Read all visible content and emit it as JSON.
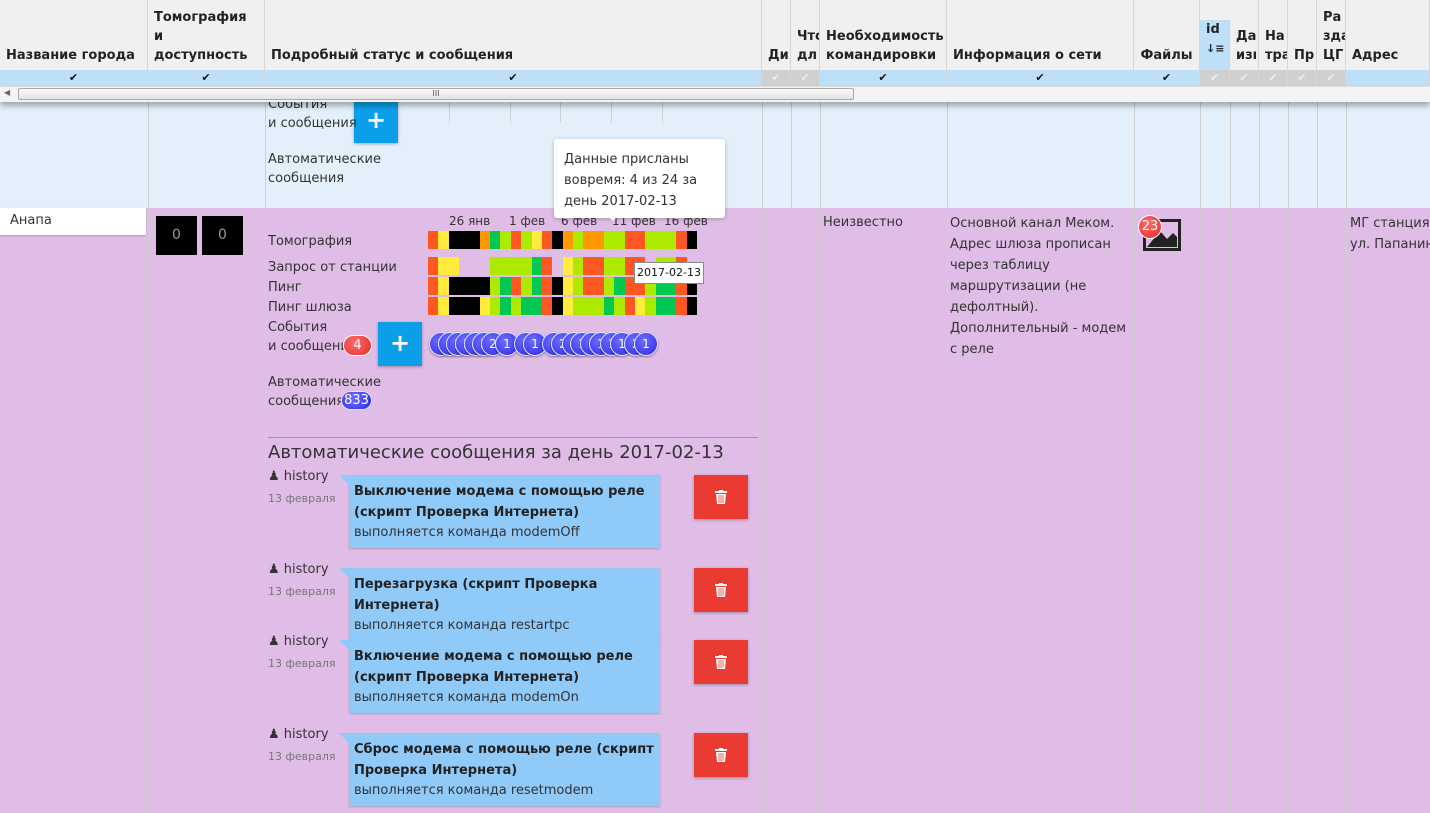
{
  "header": {
    "columns": [
      "Название города",
      "Томография и доступность",
      "Подробный статус и сообщения",
      "Ди",
      "Что дл",
      "Необходимость командировки",
      "Информация о сети",
      "Файлы",
      "id",
      "Да изı",
      "На тра",
      "Пр",
      "Ра зда ЦГ",
      "Адрес"
    ],
    "sort_icon": "sort-ascending-icon"
  },
  "filter": {
    "check": "✔"
  },
  "scrollbar": {
    "grip": "III"
  },
  "colors": {
    "red": "#ff5722",
    "yellow": "#ffeb3b",
    "black": "#000000",
    "orange": "#ff9800",
    "green": "#00c853",
    "lime": "#aeea00",
    "row_selected": "#e3f0fb",
    "row_purple": "#e0bde6"
  },
  "prev_row": {
    "events_label": "События\nи сообщения",
    "auto_label": "Автоматические\nсообщения",
    "plus": "+"
  },
  "row": {
    "city": "Анапа",
    "tomo_counts": [
      "0",
      "0"
    ],
    "timeline_dates": [
      "26 янв",
      "1 фев",
      "6 фев",
      "11 фев",
      "16 фев"
    ],
    "labels": {
      "tomography": "Томография",
      "station_request": "Запрос от станции",
      "ping": "Пинг",
      "gateway_ping": "Пинг шлюза",
      "events": "События\nи сообщения",
      "auto": "Автоматические\nсообщения"
    },
    "status_grid": {
      "tomography": [
        "red",
        "yellow",
        "black",
        "black",
        "black",
        "orange",
        "green",
        "lime",
        "red",
        "lime",
        "yellow",
        "red",
        "black",
        "orange",
        "lime",
        "orange",
        "orange",
        "lime",
        "lime",
        "red",
        "red",
        "lime",
        "lime",
        "lime",
        "red",
        "black"
      ],
      "station_request": [
        "red",
        "yellow",
        "yellow",
        "",
        "",
        "",
        "lime",
        "lime",
        "lime",
        "lime",
        "green",
        "red",
        "",
        "yellow",
        "lime",
        "red",
        "red",
        "lime",
        "lime",
        "red",
        "red",
        "",
        "lime",
        "lime",
        "red",
        ""
      ],
      "ping": [
        "red",
        "yellow",
        "black",
        "black",
        "black",
        "black",
        "lime",
        "green",
        "red",
        "lime",
        "green",
        "red",
        "black",
        "yellow",
        "lime",
        "red",
        "red",
        "lime",
        "green",
        "red",
        "red",
        "lime",
        "green",
        "green",
        "red",
        "black"
      ],
      "gateway_ping": [
        "red",
        "yellow",
        "black",
        "black",
        "black",
        "yellow",
        "lime",
        "green",
        "lime",
        "green",
        "green",
        "red",
        "black",
        "yellow",
        "lime",
        "lime",
        "lime",
        "green",
        "lime",
        "red",
        "yellow",
        "lime",
        "green",
        "green",
        "red",
        "black"
      ]
    },
    "events_count": "4",
    "plus": "+",
    "event_bubbles": [
      "1",
      "6",
      "2",
      "2",
      "2",
      "2",
      "2",
      "1",
      "1",
      "1",
      "1",
      "2",
      "1",
      "1",
      "1",
      "1",
      "1",
      "1",
      "2",
      "1"
    ],
    "auto_count": "833",
    "tooltip": "Данные присланы вовремя: 4 из 24 за день 2017-02-13",
    "hover_tooltip": "2017-02-13",
    "section_title": "Автоматические сообщения за день 2017-02-13",
    "messages": [
      {
        "author": "history",
        "date": "13 февраля",
        "title": "Выключение модема с помощью реле (скрипт Проверка Интернета)",
        "text": "выполняется команда modemOff"
      },
      {
        "author": "history",
        "date": "13 февраля",
        "title": "Перезагрузка (скрипт Проверка Интернета)",
        "text": "выполняется команда restartpc"
      },
      {
        "author": "history",
        "date": "13 февраля",
        "title": "Включение модема с помощью реле (скрипт Проверка Интернета)",
        "text": "выполняется команда modemOn"
      },
      {
        "author": "history",
        "date": "13 февраля",
        "title": "Сброс модема с помощью реле (скрипт Проверка Интернета)",
        "text": "выполняется команда resetmodem"
      }
    ],
    "trip": "Неизвестно",
    "network": "Основной канал Меком. Адрес шлюза прописан через таблицу маршрутизации (не дефолтный). Дополнительный - модем с реле",
    "files_count": "23",
    "address": "МГ станция ул. Папанин"
  }
}
